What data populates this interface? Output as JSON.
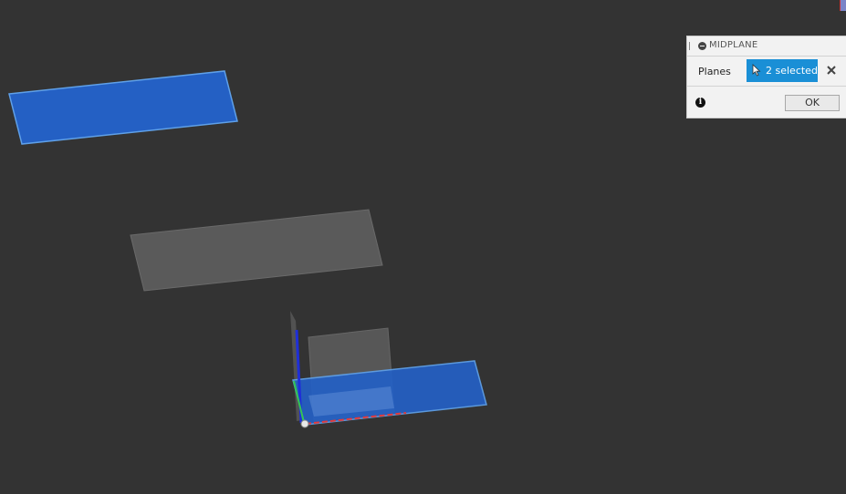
{
  "dialog": {
    "title": "MIDPLANE",
    "planes_label": "Planes",
    "selection_text": "2 selected",
    "ok_label": "OK"
  },
  "icons": {
    "collapse": "collapse-icon",
    "cursor": "cursor-icon",
    "clear": "close-icon",
    "info": "info-icon"
  },
  "colors": {
    "viewport_background": "#333333",
    "selected_plane": "#2460c4",
    "unselected_plane": "#5a5a5a",
    "selection_button": "#1a8fd6",
    "panel_background": "#f2f2f2"
  }
}
